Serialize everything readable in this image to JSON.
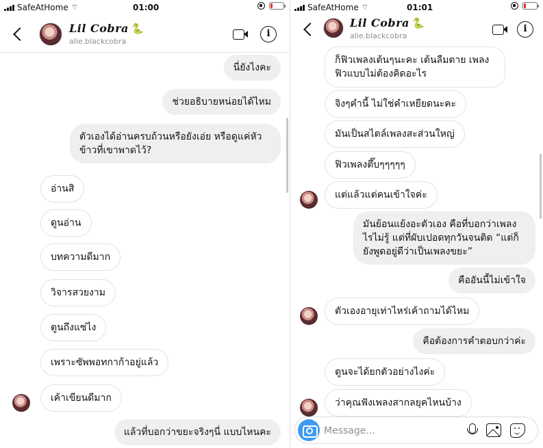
{
  "left": {
    "status": {
      "carrier": "SafeAtHome",
      "time": "01:00"
    },
    "header": {
      "name": "Lil Cobra",
      "emoji": "🐍",
      "username": "alie.blackcobra"
    },
    "messages": [
      {
        "side": "out",
        "text": "นี่ยังไงคะ"
      },
      {
        "side": "out",
        "text": "ช่วยอธิบายหน่อยได้ไหม"
      },
      {
        "side": "out",
        "text": "ตัวเองได้อ่านครบถ้วนหรือยังเอ่ย หรือดูแค่หัวข้าวที่เขาพาดไว้?"
      },
      {
        "side": "in",
        "text": "อ่านสิ"
      },
      {
        "side": "in",
        "text": "ดูนอ่าน"
      },
      {
        "side": "in",
        "text": "บทความดีมาก"
      },
      {
        "side": "in",
        "text": "วิจารสวยงาม"
      },
      {
        "side": "in",
        "text": "ตูนถึงแซ่ไง"
      },
      {
        "side": "in",
        "text": "เพราะซัพพอทกาก้าอยู่แล้ว"
      },
      {
        "side": "in",
        "text": "เค้าเขียนดีมาก"
      },
      {
        "side": "out",
        "text": "แล้วที่บอกว่าขยะจริงๆนี่ แบบไหนคะ"
      }
    ]
  },
  "right": {
    "status": {
      "carrier": "SafeAtHome",
      "time": "01:01"
    },
    "header": {
      "name": "Lil Cobra",
      "emoji": "🐍",
      "username": "alie.blackcobra"
    },
    "messages": [
      {
        "side": "in",
        "text": "ก็ฟิวเพลงเต้นๆนะคะ เต้นลืมตาย เพลงฟิวแบบไม่ต้องคิดอะไร"
      },
      {
        "side": "in",
        "text": "จิงๆคำนี้ ไม่ใช่คำเหยียดนะคะ"
      },
      {
        "side": "in",
        "text": "มันเป็นสไตล์เพลงสะส่วนใหญ่"
      },
      {
        "side": "in",
        "text": "ฟิวเพลงตึ๊บๆๆๆๆๆ"
      },
      {
        "side": "in",
        "text": "แต่แล้วแต่คนเข้าใจค่ะ"
      },
      {
        "side": "out",
        "text": "มันย้อนแย้งอะตัวเอง คือที่บอกว่าเพลงไรไม่รู้ แต่ที่ผับเปอดทุกวันจนติด “แต่ก็ยังพูดอยู่ดีว่าเป็นเพลงขยะ”"
      },
      {
        "side": "out",
        "text": "คืออันนี้ไม่เข้าใจ"
      },
      {
        "side": "in",
        "text": "ตัวเองอายุเท่าไหร่เค้าถามได้ไหม"
      },
      {
        "side": "out",
        "text": "คือต้องการคำตอบกว่าค่ะ"
      },
      {
        "side": "in",
        "text": "ตูนจะได้ยกตัวอย่างไงค่ะ"
      },
      {
        "side": "in",
        "text": "ว่าคุณฟังเพลงสากลยุคไหนบ้าง"
      }
    ],
    "composer": {
      "placeholder": "Message..."
    }
  },
  "colors": {
    "outgoing_bubble": "#efefef",
    "incoming_bubble_border": "#e2e2e2",
    "camera_button": "#3f9bf0",
    "battery_low": "#e0312b"
  },
  "battery_level": 0.15
}
